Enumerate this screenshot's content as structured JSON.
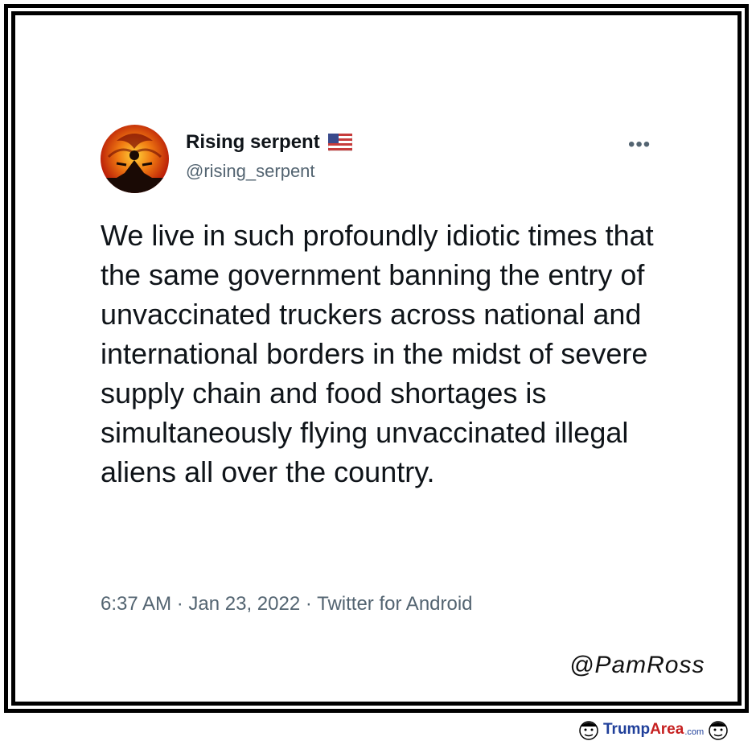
{
  "tweet": {
    "author_name": "Rising serpent",
    "author_handle": "@rising_serpent",
    "more_label": "•••",
    "text": "We live in such profoundly idiotic times that the same government banning the entry of unvaccinated truckers across national and international borders in the midst of severe supply chain and food shortages is simultaneously flying unvaccinated illegal aliens all over the country.",
    "time": "6:37 AM",
    "date": "Jan 23, 2022",
    "source": "Twitter for Android",
    "separator": "·"
  },
  "watermark": "@PamRoss",
  "site": {
    "part1": "Trump",
    "part2": "Area",
    "part3": ".com"
  },
  "icons": {
    "avatar": "avatar-image",
    "flag": "us-flag-icon",
    "more": "more-options-icon"
  },
  "colors": {
    "text": "#0f1419",
    "secondary": "#536471",
    "frame": "#000000",
    "brand_blue": "#1f3f9a",
    "brand_red": "#c62020"
  }
}
